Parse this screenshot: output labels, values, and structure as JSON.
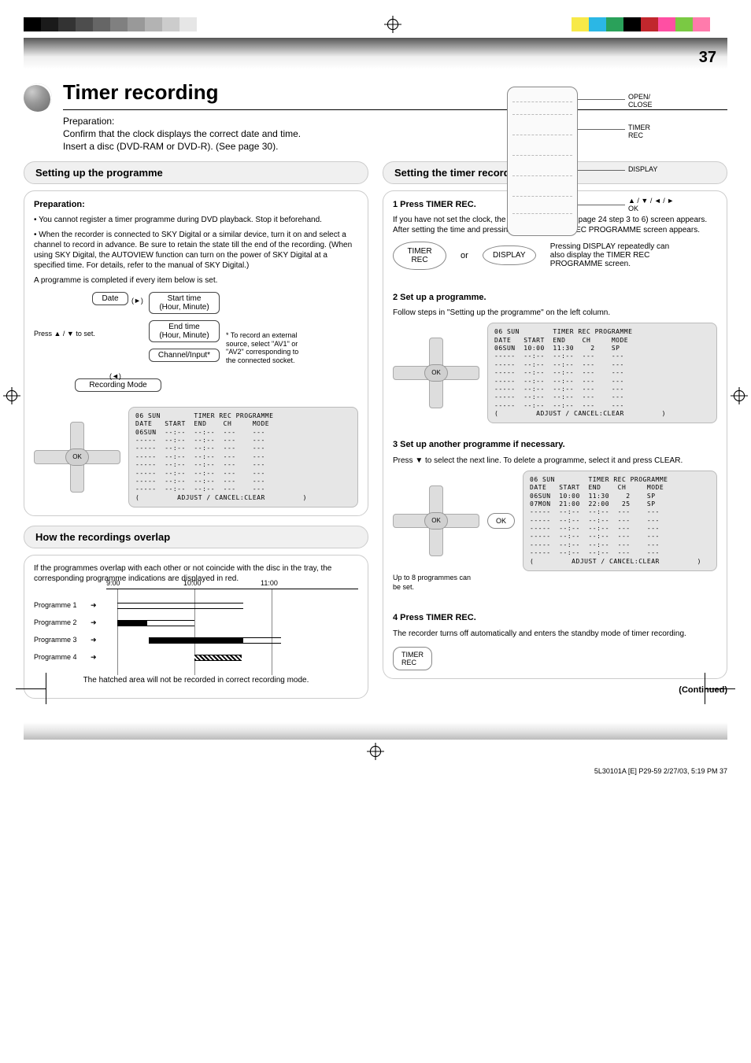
{
  "page_number": "37",
  "top_swatches_bw": [
    "#000",
    "#1a1a1a",
    "#333",
    "#4d4d4d",
    "#666",
    "#808080",
    "#999",
    "#b3b3b3",
    "#ccc",
    "#e6e6e6",
    "#fff"
  ],
  "top_swatches_cmyk": [
    "#f7e948",
    "#2bb7e5",
    "#2aa15a",
    "#000",
    "#c1272d",
    "#ff4fa3",
    "#7ac943",
    "#ff7bac",
    "#fff"
  ],
  "title": "Timer recording",
  "intro": "Preparation:\nConfirm that the clock displays the correct date and time.\nInsert a disc (DVD-RAM or DVD-R). (See page 30).",
  "remote_labels": {
    "a": "OPEN/\nCLOSE",
    "b": "TIMER\nREC",
    "c": "DISPLAY",
    "d": "▲ / ▼ / ◄ / ►\nOK"
  },
  "left_header": "Setting up the programme",
  "prep_title": "Preparation:",
  "prep_lines": [
    "• You cannot register a timer programme during DVD playback. Stop it beforehand.",
    "• When the recorder is connected to SKY Digital or a similar device, turn it on and select a channel to record in advance. Be sure to retain the state till the end of the recording. (When using SKY Digital, the AUTOVIEW function can turn on the power of SKY Digital at a specified time. For details, refer to the manual of SKY Digital.)"
  ],
  "prog_flow_caption": "A programme is completed if every item below is set.",
  "flow": {
    "date": "Date",
    "start": "Start time\n(Hour, Minute)",
    "end": "End time\n(Hour, Minute)",
    "ch": "Channel/Input*",
    "mode": "Recording Mode",
    "arr_right": "(►)",
    "arr_left": "(◄)",
    "tip_updown": "Press ▲ / ▼ to set.",
    "note": "* To record an external\nsource, select \"AV1\" or\n\"AV2\" corresponding to\nthe connected socket."
  },
  "lcd1_hdr": "06 SUN",
  "lcd1_rows": [
    [
      "DATE",
      "START",
      "END",
      "CH",
      "MODE"
    ],
    [
      "06SUN",
      "--:--",
      "--:--",
      "---",
      "---"
    ],
    [
      "-----",
      "--:--",
      "--:--",
      "---",
      "---"
    ],
    [
      "-----",
      "--:--",
      "--:--",
      "---",
      "---"
    ],
    [
      "-----",
      "--:--",
      "--:--",
      "---",
      "---"
    ],
    [
      "-----",
      "--:--",
      "--:--",
      "---",
      "---"
    ],
    [
      "-----",
      "--:--",
      "--:--",
      "---",
      "---"
    ],
    [
      "-----",
      "--:--",
      "--:--",
      "---",
      "---"
    ],
    [
      "-----",
      "--:--",
      "--:--",
      "---",
      "---"
    ]
  ],
  "lcd_footer_hint": "(         ADJUST / CANCEL:CLEAR         )",
  "overlap_header": "How the recordings overlap",
  "overlap_text": "If the programmes overlap with each other or not coincide with the disc in the tray, the corresponding programme indications are displayed in red.",
  "overlap_rows": [
    "Programme 2",
    "Programme 3",
    "Programme 4"
  ],
  "overlap_prog1": "Programme 1",
  "overlap_hours": [
    "9:00",
    "10:00",
    "11:00"
  ],
  "overlap_caption": "The hatched area will not be recorded in correct recording mode.",
  "right_header": "Setting the timer recording",
  "step1_lead": "1  Press TIMER REC.",
  "step1_text": "If you have not set the clock, the initial clock setting (   page 24 step 3 to 6) screen appears. After setting the time and pressing OK, the TIMER REC PROGRAMME screen appears.",
  "btn_timer": "TIMER\nREC",
  "btn_or": "or",
  "btn_display": "DISPLAY",
  "step1_tip": "Pressing DISPLAY repeatedly can\nalso display the TIMER REC\nPROGRAMME screen.",
  "step2_lead": "2  Set up a programme.",
  "step2_text": "Follow steps in \"Setting up the programme\" on the left column.",
  "lcd2_rows": [
    [
      "DATE",
      "START",
      "END",
      "CH",
      "MODE"
    ],
    [
      "06SUN",
      "10:00",
      "11:30",
      "  2",
      "SP"
    ],
    [
      "-----",
      "--:--",
      "--:--",
      "---",
      "---"
    ],
    [
      "-----",
      "--:--",
      "--:--",
      "---",
      "---"
    ],
    [
      "-----",
      "--:--",
      "--:--",
      "---",
      "---"
    ],
    [
      "-----",
      "--:--",
      "--:--",
      "---",
      "---"
    ],
    [
      "-----",
      "--:--",
      "--:--",
      "---",
      "---"
    ],
    [
      "-----",
      "--:--",
      "--:--",
      "---",
      "---"
    ],
    [
      "-----",
      "--:--",
      "--:--",
      "---",
      "---"
    ]
  ],
  "step3_lead": "3  Set up another programme if necessary.",
  "step3_text": "Press ▼ to select the next line. To delete a programme, select it and press CLEAR.",
  "step3_hint": "Up to 8 programmes can\nbe set.",
  "lcd3_rows": [
    [
      "DATE",
      "START",
      "END",
      "CH",
      "MODE"
    ],
    [
      "06SUN",
      "10:00",
      "11:30",
      "  2",
      "SP"
    ],
    [
      "07MON",
      "21:00",
      "22:00",
      " 25",
      "SP"
    ],
    [
      "-----",
      "--:--",
      "--:--",
      "---",
      "---"
    ],
    [
      "-----",
      "--:--",
      "--:--",
      "---",
      "---"
    ],
    [
      "-----",
      "--:--",
      "--:--",
      "---",
      "---"
    ],
    [
      "-----",
      "--:--",
      "--:--",
      "---",
      "---"
    ],
    [
      "-----",
      "--:--",
      "--:--",
      "---",
      "---"
    ],
    [
      "-----",
      "--:--",
      "--:--",
      "---",
      "---"
    ]
  ],
  "btn_ok": "OK",
  "step4_lead": "4  Press TIMER REC.",
  "step4_text": "The recorder turns off automatically and enters the standby mode of timer recording.",
  "cont": "(Continued)",
  "foot": "5L30101A [E] P29-59  2/27/03, 5:19 PM 37"
}
